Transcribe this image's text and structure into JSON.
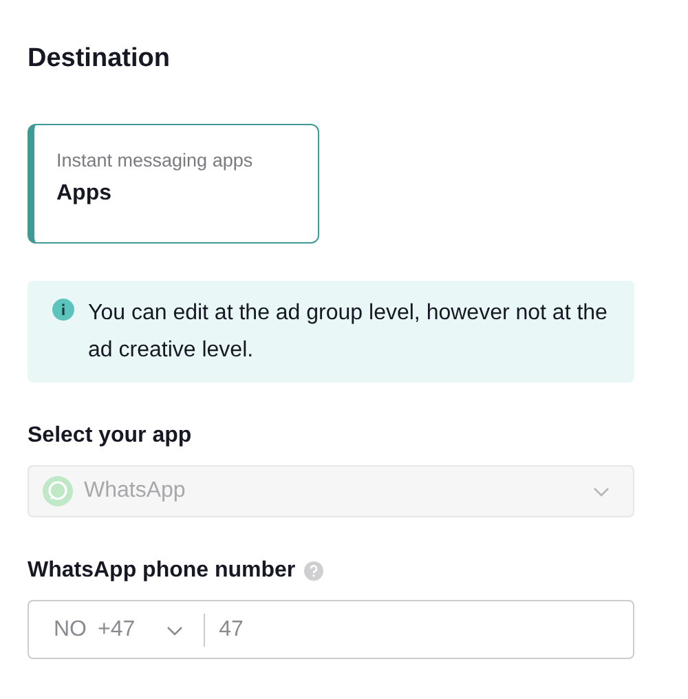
{
  "section": {
    "title": "Destination"
  },
  "destination_card": {
    "subtitle": "Instant messaging apps",
    "label": "Apps",
    "selected": true
  },
  "info": {
    "text": "You can edit at the ad group level, however not at the ad creative level."
  },
  "app_select": {
    "label": "Select your app",
    "value": "WhatsApp",
    "disabled": true
  },
  "phone": {
    "label": "WhatsApp phone number",
    "country": "NO",
    "code": "+47",
    "placeholder": "47"
  }
}
